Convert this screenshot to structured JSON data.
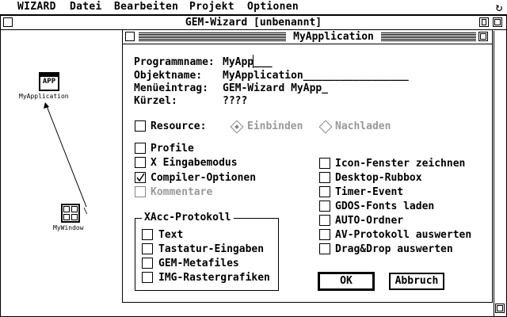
{
  "menubar": {
    "items": [
      "WIZARD",
      "Datei",
      "Bearbeiten",
      "Projekt",
      "Optionen"
    ],
    "corner_icon": "refresh-icon"
  },
  "outer_window": {
    "title": "GEM-Wizard  [unbenannt]"
  },
  "desktop": {
    "app_icon_text": "APP",
    "app_icon_label": "MyApplication",
    "window_icon_label": "MyWindow"
  },
  "dialog": {
    "title": "MyApplication",
    "fields": [
      {
        "label": "Programmname:",
        "value": "MyApp___"
      },
      {
        "label": "Objektname:",
        "value": "MyApplication_________________"
      },
      {
        "label": "Menüeintrag:",
        "value": "GEM-Wizard MyApp_"
      },
      {
        "label": "Kürzel:",
        "value": "????"
      }
    ],
    "resource": {
      "label": "Resource:",
      "options": [
        "Einbinden",
        "Nachladen"
      ]
    },
    "left_checks": [
      {
        "label": "Profile",
        "checked": false,
        "enabled": true
      },
      {
        "label": "X Eingabemodus",
        "checked": false,
        "enabled": true
      },
      {
        "label": "Compiler-Optionen",
        "checked": true,
        "enabled": true
      },
      {
        "label": "Kommentare",
        "checked": false,
        "enabled": false
      }
    ],
    "xacc": {
      "title": "XAcc-Protokoll",
      "items": [
        "Text",
        "Tastatur-Eingaben",
        "GEM-Metafiles",
        "IMG-Rastergrafiken"
      ]
    },
    "right_checks": [
      "Icon-Fenster zeichnen",
      "Desktop-Rubbox",
      "Timer-Event",
      "GDOS-Fonts laden",
      "AUTO-Ordner",
      "AV-Protokoll auswerten",
      "Drag&Drop auswerten"
    ],
    "ok_label": "OK",
    "cancel_label": "Abbruch"
  }
}
